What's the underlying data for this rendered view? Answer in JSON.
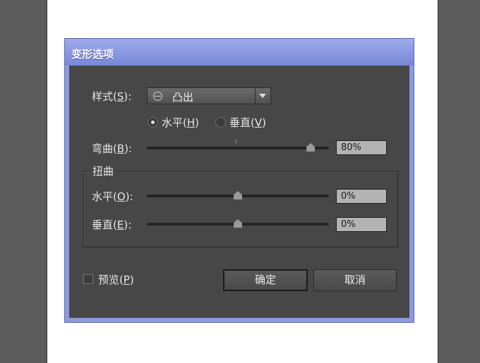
{
  "dialog": {
    "title": "变形选项",
    "style": {
      "label": "样式",
      "mnemonic": "S",
      "value": "凸出",
      "value_icon": "bulge-icon"
    },
    "orientation": {
      "horizontal": {
        "label": "水平",
        "mnemonic": "H",
        "selected": true
      },
      "vertical": {
        "label": "垂直",
        "mnemonic": "V",
        "selected": false
      }
    },
    "bend": {
      "label": "弯曲",
      "mnemonic": "B",
      "value": "80%",
      "percent": 80
    },
    "distortion": {
      "group_label": "扭曲",
      "horizontal": {
        "label": "水平",
        "mnemonic": "O",
        "value": "0%",
        "percent": 0
      },
      "vertical": {
        "label": "垂直",
        "mnemonic": "E",
        "value": "0%",
        "percent": 0
      }
    },
    "preview": {
      "label": "预览",
      "mnemonic": "P",
      "checked": false
    },
    "buttons": {
      "ok": "确定",
      "cancel": "取消"
    }
  },
  "colors": {
    "title_bar": "#8c9ae0",
    "panel": "#474747",
    "field_bg": "#b3b3b3",
    "page_bg": "#5c5c5c"
  }
}
